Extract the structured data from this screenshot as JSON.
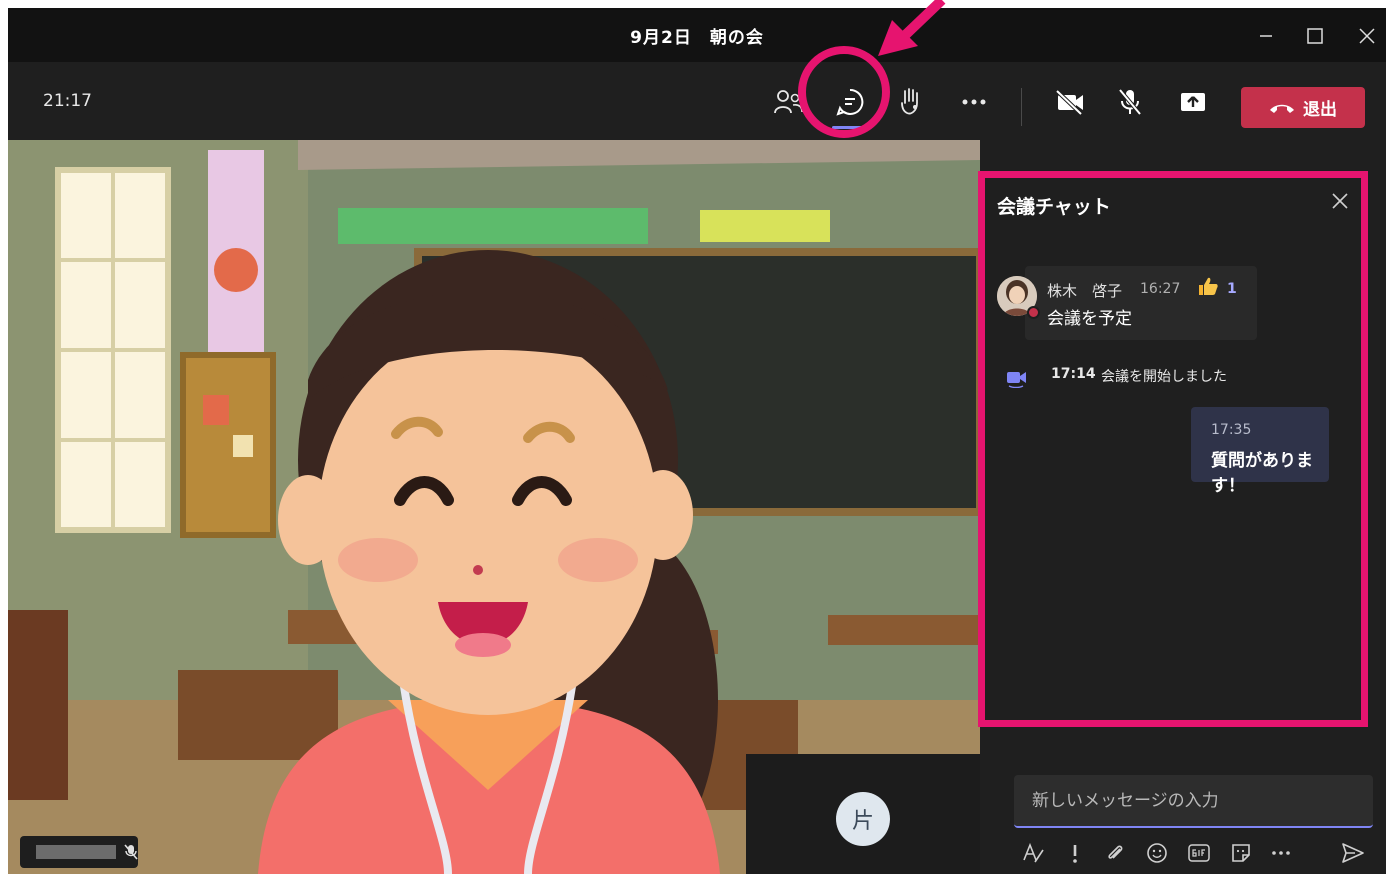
{
  "window": {
    "title": "9月2日　朝の会"
  },
  "toolbar": {
    "clock": "21:17",
    "leave_label": "退出",
    "icons": [
      "people-icon",
      "chat-icon",
      "raise-hand-icon",
      "more-icon",
      "camera-off-icon",
      "mic-off-icon",
      "share-icon",
      "phone-hangup-icon"
    ]
  },
  "participant": {
    "avatar_initial": "片"
  },
  "chat": {
    "title": "会議チャット",
    "messages": [
      {
        "sender": "株木　啓子",
        "time": "16:27",
        "reaction_count": "1",
        "text": "会議を予定"
      }
    ],
    "system": {
      "time": "17:14",
      "text": "会議を開始しました"
    },
    "my_message": {
      "time": "17:35",
      "text": "質問があります！"
    },
    "compose_placeholder": "新しいメッセージの入力"
  },
  "colors": {
    "accent": "#7f85f5",
    "leave": "#c4314b",
    "highlight": "#e6146f"
  }
}
